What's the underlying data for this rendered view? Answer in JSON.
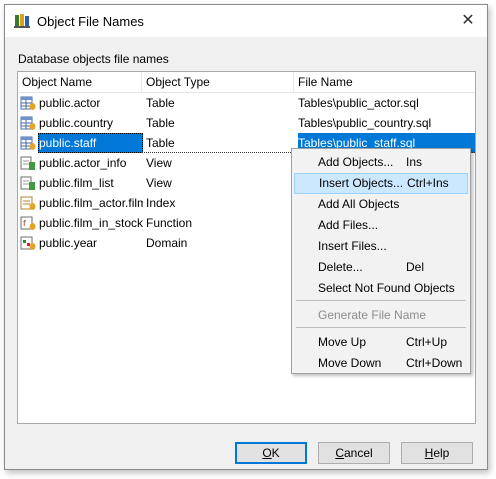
{
  "window": {
    "title": "Object File Names",
    "close_glyph": "✕"
  },
  "group_label": "Database objects file names",
  "columns": [
    "Object Name",
    "Object Type",
    "File Name"
  ],
  "rows": [
    {
      "icon": "table-icon",
      "name": "public.actor",
      "type": "Table",
      "file": "Tables\\public_actor.sql"
    },
    {
      "icon": "table-icon",
      "name": "public.country",
      "type": "Table",
      "file": "Tables\\public_country.sql"
    },
    {
      "icon": "table-icon",
      "name": "public.staff",
      "type": "Table",
      "file": "Tables\\public_staff.sql",
      "selected": true
    },
    {
      "icon": "view-icon",
      "name": "public.actor_info",
      "type": "View",
      "file": ""
    },
    {
      "icon": "view-icon",
      "name": "public.film_list",
      "type": "View",
      "file": ""
    },
    {
      "icon": "index-icon",
      "name": "public.film_actor.film_",
      "type": "Index",
      "file": ""
    },
    {
      "icon": "function-icon",
      "name": "public.film_in_stock (",
      "type": "Function",
      "file": ""
    },
    {
      "icon": "domain-icon",
      "name": "public.year",
      "type": "Domain",
      "file": ""
    }
  ],
  "context_menu": {
    "items": [
      {
        "label": "Add Objects...",
        "shortcut": "Ins"
      },
      {
        "label": "Insert Objects...",
        "shortcut": "Ctrl+Ins",
        "highlighted": true
      },
      {
        "label": "Add All Objects",
        "shortcut": ""
      },
      {
        "label": "Add Files...",
        "shortcut": ""
      },
      {
        "label": "Insert Files...",
        "shortcut": ""
      },
      {
        "label": "Delete...",
        "shortcut": "Del"
      },
      {
        "label": "Select Not Found Objects",
        "shortcut": ""
      },
      {
        "label": "Generate File Name",
        "shortcut": "",
        "disabled": true
      },
      {
        "label": "Move Up",
        "shortcut": "Ctrl+Up"
      },
      {
        "label": "Move Down",
        "shortcut": "Ctrl+Down"
      }
    ]
  },
  "buttons": {
    "ok": {
      "hotkey": "O",
      "rest": "K"
    },
    "cancel": {
      "hotkey": "C",
      "rest": "ancel"
    },
    "help": {
      "hotkey": "H",
      "rest": "elp"
    }
  },
  "colors": {
    "selection": "#0078d7",
    "menu_highlight": "#cce8ff",
    "dialog_bg": "#f0f0f0"
  }
}
